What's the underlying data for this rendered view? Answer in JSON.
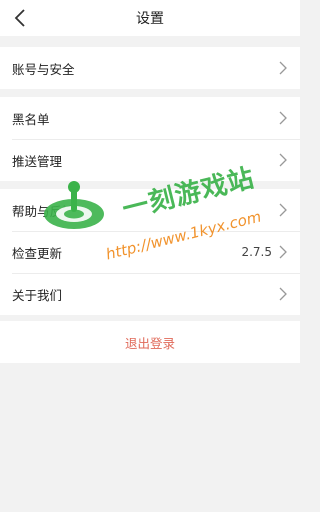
{
  "header": {
    "title": "设置"
  },
  "group1": [
    {
      "label": "账号与安全"
    }
  ],
  "group2": [
    {
      "label": "黑名单"
    },
    {
      "label": "推送管理"
    }
  ],
  "group3": [
    {
      "label": "帮助与反馈"
    },
    {
      "label": "检查更新",
      "value": "2.7.5"
    },
    {
      "label": "关于我们"
    }
  ],
  "logout": {
    "label": "退出登录"
  },
  "watermark": {
    "text": "一刻游戏站",
    "url": "http://www.1kyx.com"
  },
  "colors": {
    "logout": "#e06a5a",
    "background": "#f2f2f2",
    "watermark_green": "#3bb34a",
    "watermark_orange": "#f08a1c"
  }
}
